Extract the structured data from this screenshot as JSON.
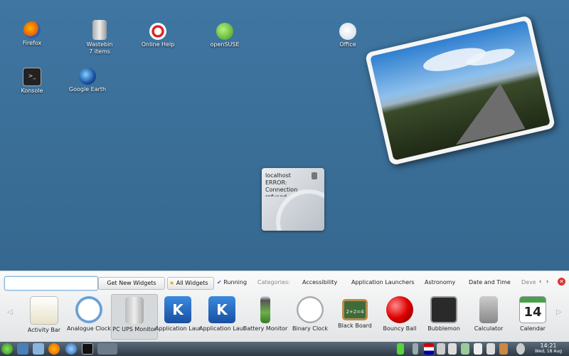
{
  "desktop": {
    "icons": [
      {
        "label": "Firefox",
        "icon": "firefox-icon"
      },
      {
        "label": "Wastebin",
        "sublabel": "7 items",
        "icon": "trash-icon"
      },
      {
        "label": "Online Help",
        "icon": "help-lifebuoy-icon"
      },
      {
        "label": "openSUSE",
        "icon": "opensuse-icon"
      },
      {
        "label": "Office",
        "icon": "office-icon"
      },
      {
        "label": "Konsole",
        "icon": "terminal-icon"
      },
      {
        "label": "Google Earth",
        "icon": "google-earth-icon"
      }
    ],
    "note_widget": {
      "text": "localhost ERROR: Connection refused"
    }
  },
  "explorer": {
    "search_placeholder": "",
    "get_new_widgets": "Get New Widgets",
    "all_widgets": "All Widgets",
    "running": "Running",
    "categories_label": "Categories:",
    "categories": [
      "Accessibility",
      "Application Launchers",
      "Astronomy",
      "Date and Time",
      "Deve"
    ],
    "widgets": [
      {
        "label": "Activity Bar",
        "icon": "activity-bar-icon"
      },
      {
        "label": "Analogue Clock",
        "icon": "analogue-clock-icon"
      },
      {
        "label": "PC UPS Monitor",
        "icon": "ups-icon",
        "selected": true
      },
      {
        "label": "Application Launcher",
        "icon": "kde-launcher-icon"
      },
      {
        "label": "Application Launcher",
        "icon": "kde-launcher-icon"
      },
      {
        "label": "Battery Monitor",
        "icon": "battery-icon"
      },
      {
        "label": "Binary Clock",
        "icon": "binary-clock-icon"
      },
      {
        "label": "Black Board",
        "icon": "blackboard-icon"
      },
      {
        "label": "Bouncy Ball",
        "icon": "bouncy-ball-icon"
      },
      {
        "label": "Bubblemon",
        "icon": "bubblemon-icon"
      },
      {
        "label": "Calculator",
        "icon": "calculator-icon"
      },
      {
        "label": "Calendar",
        "icon": "calendar-icon"
      }
    ]
  },
  "taskbar": {
    "time": "14:21",
    "date": "Wed, 18 Aug"
  },
  "colors": {
    "desktop": "#3a6f9a",
    "taskbar": "#3b4856",
    "accent": "#7fb0de"
  }
}
